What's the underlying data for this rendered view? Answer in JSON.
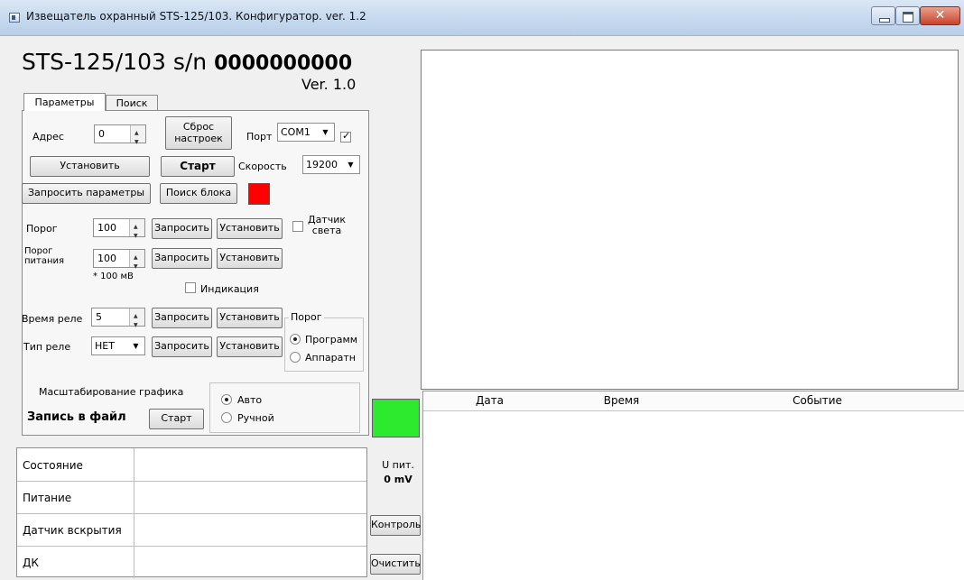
{
  "window": {
    "title": "Извещатель охранный STS-125/103. Конфигуратор. ver. 1.2",
    "close_glyph": "✕"
  },
  "header": {
    "model": "STS-125/103",
    "sn_label": "s/n",
    "serial": "0000000000",
    "version": "Ver. 1.0"
  },
  "tabs": [
    {
      "label": "Параметры",
      "active": true
    },
    {
      "label": "Поиск",
      "active": false
    }
  ],
  "params": {
    "address_label": "Адрес",
    "address_value": "0",
    "reset_button": "Сброс настроек",
    "port_label": "Порт",
    "port_value": "COM1",
    "port_checked": true,
    "set_button": "Установить",
    "start_button": "Старт",
    "speed_label": "Скорость",
    "speed_value": "19200",
    "request_params_button": "Запросить параметры",
    "search_block_button": "Поиск блока",
    "status_color": "#ff0000",
    "threshold_label": "Порог",
    "threshold_value": "100",
    "request_label": "Запросить",
    "install_label": "Установить",
    "light_sensor_label": "Датчик света",
    "power_threshold_label": "Порог питания",
    "power_threshold_value": "100",
    "unit_note": "* 100 мВ",
    "indication_label": "Индикация",
    "relay_time_label": "Время реле",
    "relay_time_value": "5",
    "relay_type_label": "Тип реле",
    "relay_type_value": "НЕТ",
    "threshold_group_label": "Порог",
    "threshold_program": "Программ",
    "threshold_hardware": "Аппаратн",
    "scale_label": "Масштабирование графика",
    "scale_auto": "Авто",
    "scale_manual": "Ручной",
    "record_label": "Запись в файл",
    "record_start": "Старт"
  },
  "status_table": {
    "rows": [
      "Состояние",
      "Питание",
      "Датчик вскрытия",
      "ДК"
    ]
  },
  "indicator": {
    "color": "#2eea2e",
    "upit_label": "U пит.",
    "upit_value": "0 mV",
    "control_button": "Контроль",
    "clear_button": "Очистить"
  },
  "log": {
    "columns": [
      "Дата",
      "Время",
      "Событие"
    ]
  }
}
